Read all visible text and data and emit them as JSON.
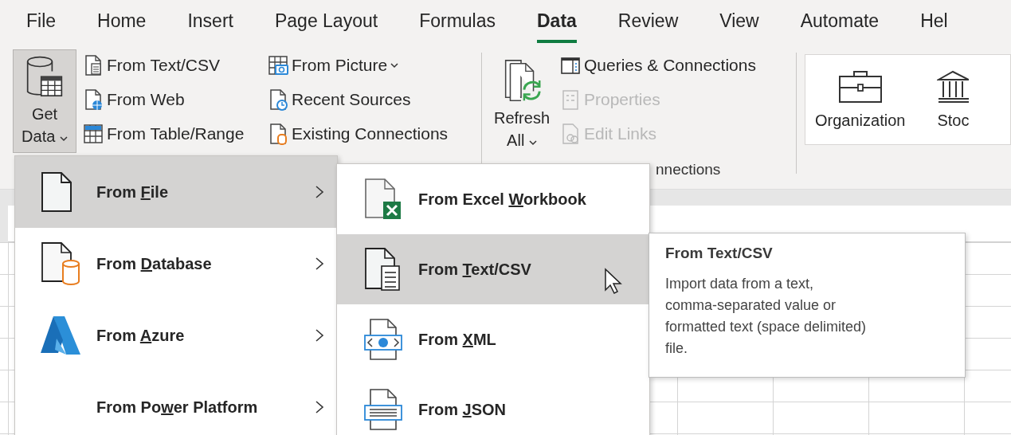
{
  "tabs": [
    {
      "label": "File",
      "selected": false
    },
    {
      "label": "Home",
      "selected": false
    },
    {
      "label": "Insert",
      "selected": false
    },
    {
      "label": "Page Layout",
      "selected": false
    },
    {
      "label": "Formulas",
      "selected": false
    },
    {
      "label": "Data",
      "selected": true
    },
    {
      "label": "Review",
      "selected": false
    },
    {
      "label": "View",
      "selected": false
    },
    {
      "label": "Automate",
      "selected": false
    },
    {
      "label": "Hel",
      "selected": false
    }
  ],
  "get_data": {
    "label_lines": [
      "Get",
      "Data"
    ],
    "pressed": true
  },
  "source_columns": [
    [
      {
        "label": "From Text/CSV",
        "kind": "text"
      },
      {
        "label": "From Web",
        "kind": "web"
      },
      {
        "label": "From Table/Range",
        "kind": "table"
      }
    ],
    [
      {
        "label": "From Picture",
        "kind": "picture",
        "dropdown": true
      },
      {
        "label": "Recent Sources",
        "kind": "clock"
      },
      {
        "label": "Existing Connections",
        "kind": "db"
      }
    ]
  ],
  "refresh": {
    "label_lines": [
      "Refresh",
      "All"
    ]
  },
  "query_items": [
    {
      "label": "Queries & Connections",
      "kind": "panel",
      "disabled": false
    },
    {
      "label": "Properties",
      "kind": "props",
      "disabled": true
    },
    {
      "label": "Edit Links",
      "kind": "links",
      "disabled": true
    }
  ],
  "query_group_label": "nnections",
  "data_types": [
    {
      "label": "Organization",
      "kind": "briefcase"
    },
    {
      "label": "Stoc",
      "kind": "bank"
    }
  ],
  "menu": [
    {
      "parts": [
        "From ",
        "F",
        "ile"
      ],
      "kind": "file",
      "selected": true
    },
    {
      "parts": [
        "From ",
        "D",
        "atabase"
      ],
      "kind": "database",
      "selected": false
    },
    {
      "parts": [
        "From ",
        "A",
        "zure"
      ],
      "kind": "azure",
      "selected": false
    },
    {
      "parts": [
        "From Po",
        "w",
        "er Platform"
      ],
      "selected": false
    }
  ],
  "submenu": [
    {
      "parts": [
        "From Excel ",
        "W",
        "orkbook"
      ],
      "kind": "excel",
      "selected": false
    },
    {
      "parts": [
        "From ",
        "T",
        "ext/CSV"
      ],
      "kind": "textfile",
      "selected": true
    },
    {
      "parts": [
        "From ",
        "X",
        "ML"
      ],
      "kind": "xml",
      "selected": false
    },
    {
      "parts": [
        "From ",
        "J",
        "SON"
      ],
      "kind": "json",
      "selected": false
    }
  ],
  "tooltip": {
    "title": "From Text/CSV",
    "body_lines": [
      "Import data from a text,",
      "comma-separated value or",
      "formatted text (space delimited)",
      "file."
    ]
  }
}
